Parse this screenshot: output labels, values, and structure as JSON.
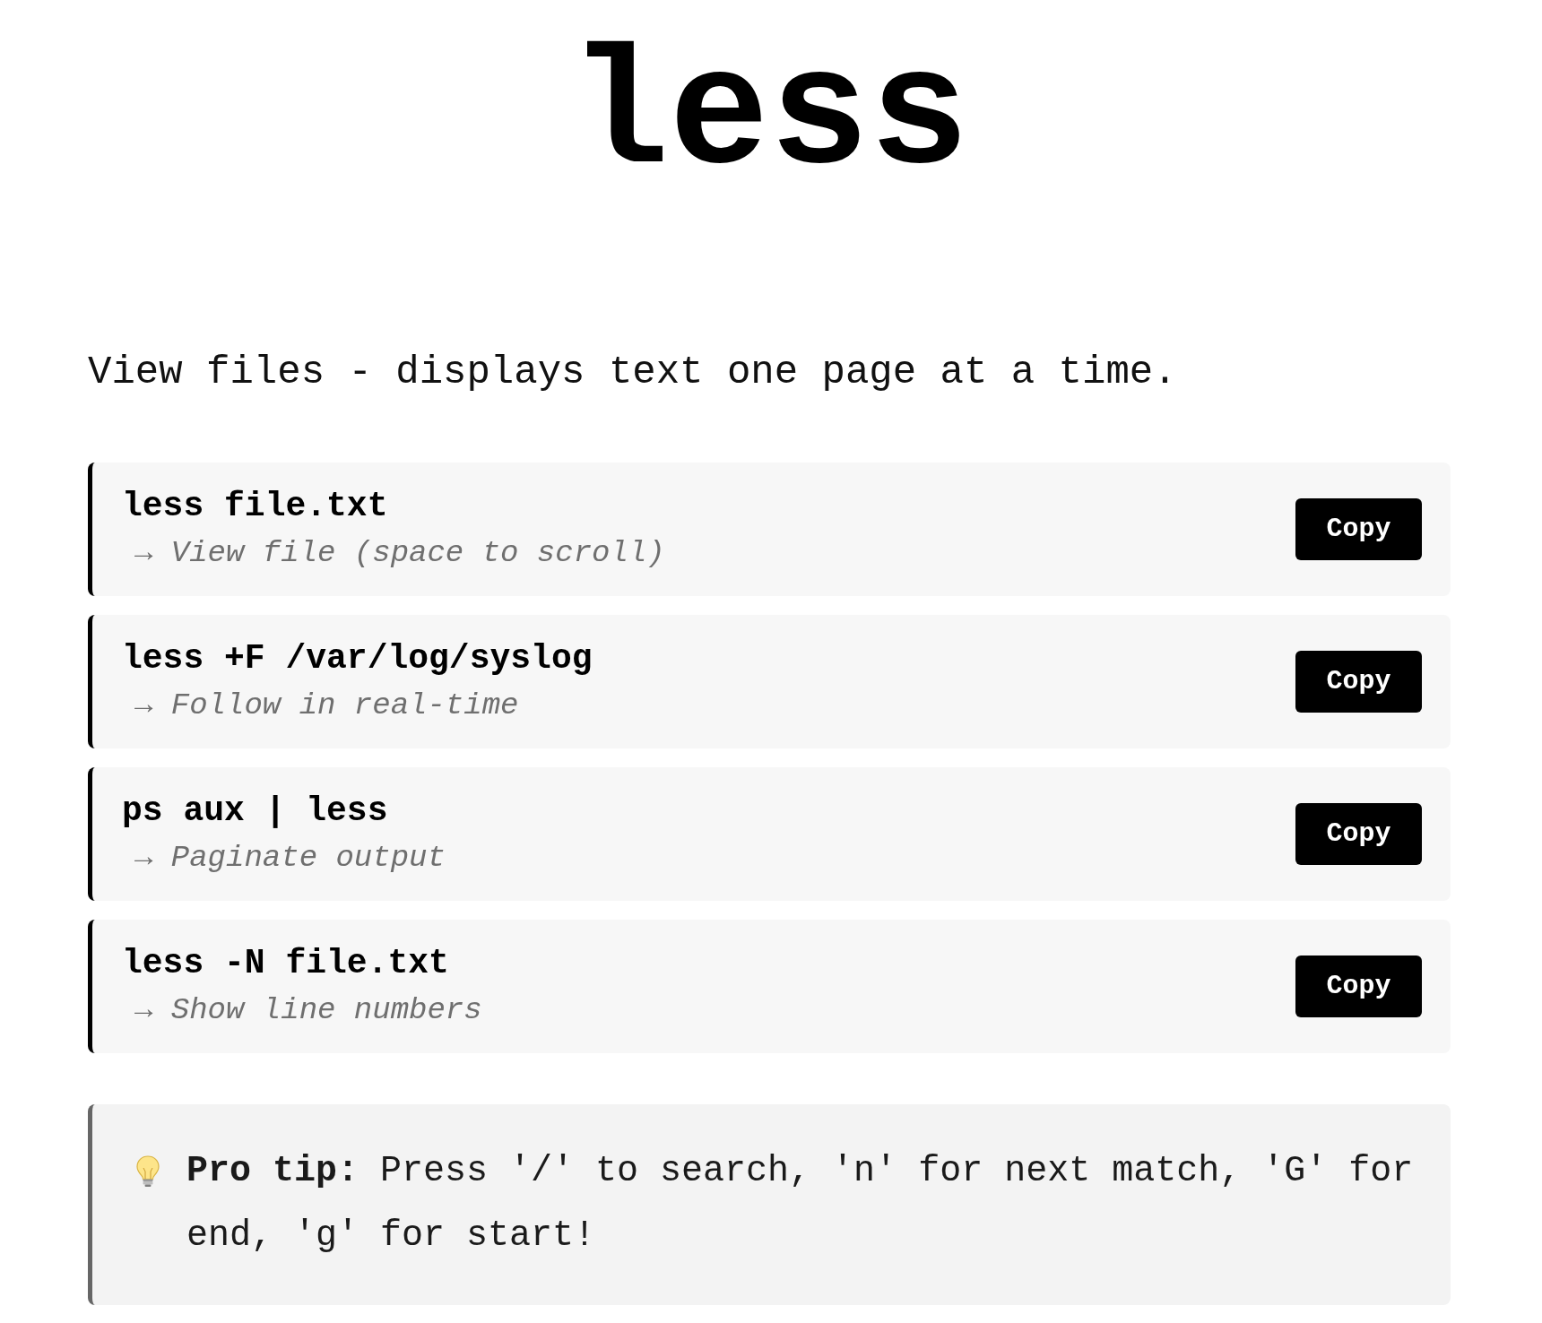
{
  "title": "less",
  "subtitle": "View files - displays text one page at a time.",
  "commands": [
    {
      "command": "less file.txt",
      "description": "→ View file (space to scroll)",
      "button": "Copy"
    },
    {
      "command": "less +F /var/log/syslog",
      "description": "→ Follow in real-time",
      "button": "Copy"
    },
    {
      "command": "ps aux | less",
      "description": "→ Paginate output",
      "button": "Copy"
    },
    {
      "command": "less -N file.txt",
      "description": "→ Show line numbers",
      "button": "Copy"
    }
  ],
  "tip": {
    "text": "**Pro tip:** Press '/' to search, 'n' for next match, 'G' for end, 'g' for start!"
  }
}
